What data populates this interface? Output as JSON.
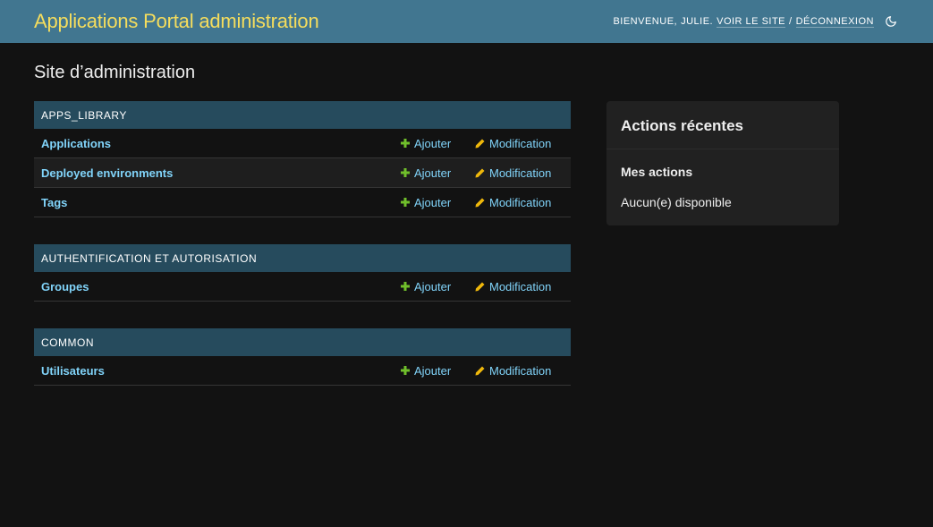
{
  "header": {
    "branding": "Applications Portal administration",
    "welcome": "Bienvenue,",
    "username": "Julie.",
    "view_site": "Voir le site",
    "separator": "/",
    "logout": "Déconnexion",
    "theme_icon": "moon-icon"
  },
  "page": {
    "title": "Site d’administration"
  },
  "modules": [
    {
      "caption": "Apps_library",
      "models": [
        {
          "name": "Applications",
          "add": "Ajouter",
          "change": "Modification"
        },
        {
          "name": "Deployed environments",
          "add": "Ajouter",
          "change": "Modification"
        },
        {
          "name": "Tags",
          "add": "Ajouter",
          "change": "Modification"
        }
      ]
    },
    {
      "caption": "Authentification et autorisation",
      "models": [
        {
          "name": "Groupes",
          "add": "Ajouter",
          "change": "Modification"
        }
      ]
    },
    {
      "caption": "Common",
      "models": [
        {
          "name": "Utilisateurs",
          "add": "Ajouter",
          "change": "Modification"
        }
      ]
    }
  ],
  "recent_actions": {
    "title": "Actions récentes",
    "my_actions": "Mes actions",
    "none_available": "Aucun(e) disponible"
  },
  "icons": {
    "add": "plus-icon",
    "change": "pencil-icon"
  },
  "colors": {
    "header_bg": "#417690",
    "branding": "#f5dd5d",
    "caption_bg": "#264b5d",
    "link": "#81d4fa",
    "add_icon": "#70bf2b",
    "change_icon": "#efb80b",
    "background": "#121212"
  }
}
